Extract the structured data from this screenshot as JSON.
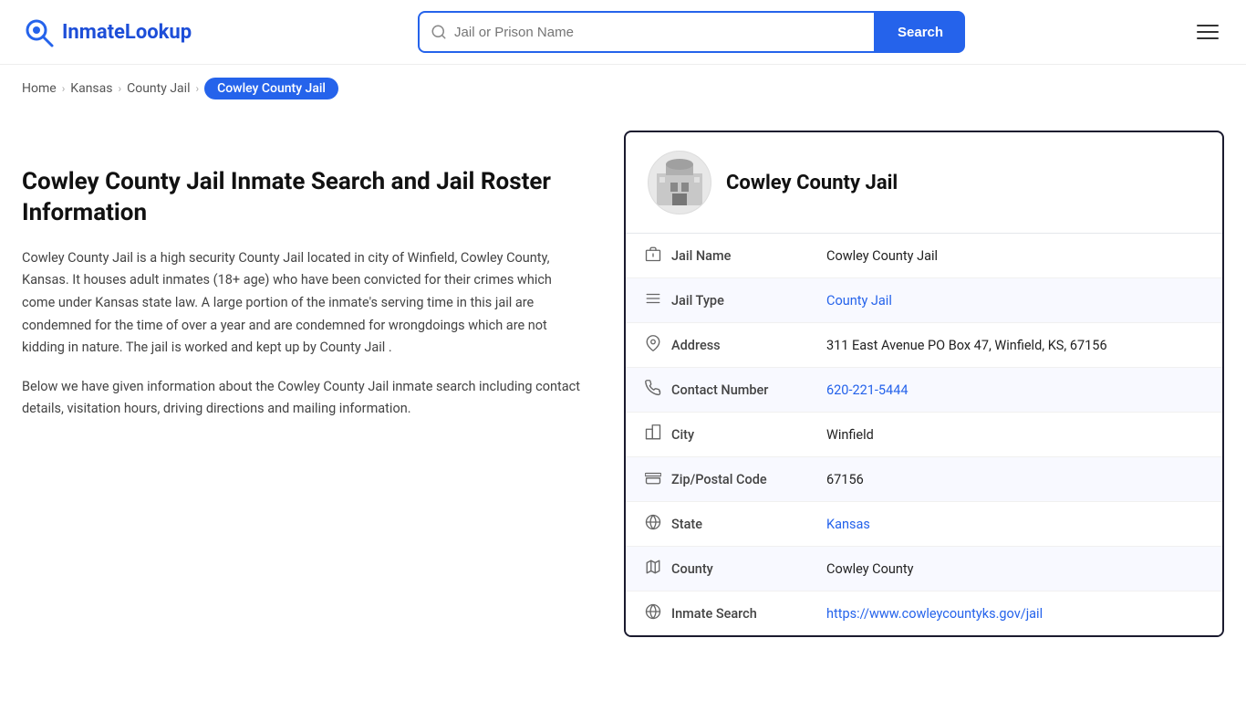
{
  "header": {
    "logo_text": "InmateLookup",
    "search_placeholder": "Jail or Prison Name",
    "search_button_label": "Search"
  },
  "breadcrumb": {
    "items": [
      {
        "label": "Home",
        "href": "#"
      },
      {
        "label": "Kansas",
        "href": "#"
      },
      {
        "label": "County Jail",
        "href": "#"
      },
      {
        "label": "Cowley County Jail",
        "current": true
      }
    ]
  },
  "left": {
    "title": "Cowley County Jail Inmate Search and Jail Roster Information",
    "description1": "Cowley County Jail is a high security County Jail located in city of Winfield, Cowley County, Kansas. It houses adult inmates (18+ age) who have been convicted for their crimes which come under Kansas state law. A large portion of the inmate's serving time in this jail are condemned for the time of over a year and are condemned for wrongdoings which are not kidding in nature. The jail is worked and kept up by County Jail .",
    "description2": "Below we have given information about the Cowley County Jail inmate search including contact details, visitation hours, driving directions and mailing information."
  },
  "facility": {
    "name": "Cowley County Jail",
    "rows": [
      {
        "icon": "jail-icon",
        "label": "Jail Name",
        "value": "Cowley County Jail",
        "link": null
      },
      {
        "icon": "type-icon",
        "label": "Jail Type",
        "value": "County Jail",
        "link": "#"
      },
      {
        "icon": "address-icon",
        "label": "Address",
        "value": "311 East Avenue PO Box 47, Winfield, KS, 67156",
        "link": null
      },
      {
        "icon": "phone-icon",
        "label": "Contact Number",
        "value": "620-221-5444",
        "link": "tel:6202215444"
      },
      {
        "icon": "city-icon",
        "label": "City",
        "value": "Winfield",
        "link": null
      },
      {
        "icon": "zip-icon",
        "label": "Zip/Postal Code",
        "value": "67156",
        "link": null
      },
      {
        "icon": "state-icon",
        "label": "State",
        "value": "Kansas",
        "link": "#"
      },
      {
        "icon": "county-icon",
        "label": "County",
        "value": "Cowley County",
        "link": null
      },
      {
        "icon": "web-icon",
        "label": "Inmate Search",
        "value": "https://www.cowleycountyks.gov/jail",
        "link": "https://www.cowleycountyks.gov/jail"
      }
    ]
  }
}
